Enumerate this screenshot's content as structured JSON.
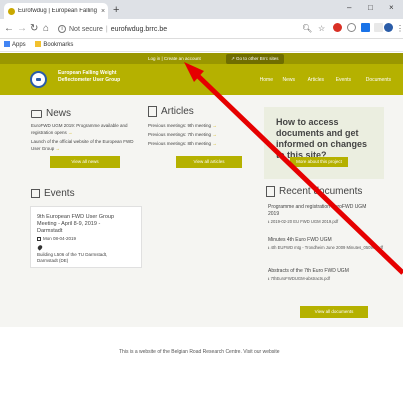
{
  "browser": {
    "tab_title": "Eurofwdug | European Falling We",
    "address_security": "Not secure",
    "address_url": "eurofwdug.brrc.be",
    "bookmarks": [
      "Apps",
      "Bookmarks"
    ],
    "minimize": "–",
    "maximize": "□",
    "close": "×",
    "new_tab": "+"
  },
  "site": {
    "login_text": "Log in | Create an account",
    "other_sites": "Go to other Brrc sites",
    "brand_line1": "European Falling Weight",
    "brand_line2": "Deflectometer User Group",
    "nav": [
      "Home",
      "News",
      "Articles",
      "Events",
      "Documents"
    ],
    "news": {
      "title": "News",
      "items": [
        "EuroFWD UGM 2019: Programme available and registration opens",
        "Launch of the official website of the European FWD User Group"
      ],
      "button": "View all news"
    },
    "articles": {
      "title": "Articles",
      "items": [
        "Previous meetings: 9th meeting",
        "Previous meetings: 7th meeting",
        "Previous meetings: 8th meeting"
      ],
      "button": "View all articles"
    },
    "promo": {
      "text_line1": "How to access",
      "text_line2": "documents and get",
      "text_line3": "informed on changes",
      "text_line4": "to this site?",
      "button": "More about this project"
    },
    "events": {
      "title": "Events",
      "card_title_line1": "9th European FWD User Group",
      "card_title_line2": "Meeting - April 8-9, 2019 -",
      "card_title_line3": "Darmstadt",
      "date": "Mon 08-04-2019",
      "location_line1": "Building L506 of the TU Darmstadt,",
      "location_line2": "Darmstadt (DE)"
    },
    "documents": {
      "title": "Recent documents",
      "items": [
        {
          "title_line1": "Programme and registration EuroFWD UGM",
          "title_line2": "2019",
          "file": "2019-02-20 EU FWD UGM 2019.pdf"
        },
        {
          "title_line1": "Minutes 4th Euro FWD UGM",
          "title_line2": "",
          "file": "4th EUFWD mtg - Trondheim June 2009 Minutes_0509G.pdf"
        },
        {
          "title_line1": "Abstracts of the 7th Euro FWD UGM",
          "title_line2": "",
          "file": "7thEuroFWDUGM-abstracts.pdf"
        }
      ],
      "button": "View all documents"
    },
    "footer": "This is a website of the Belgian Road Research Centre. Visit our website"
  },
  "colors": {
    "olive": "#b5b100",
    "olive_dark": "#9a9700",
    "annotation_arrow": "#e60000"
  }
}
